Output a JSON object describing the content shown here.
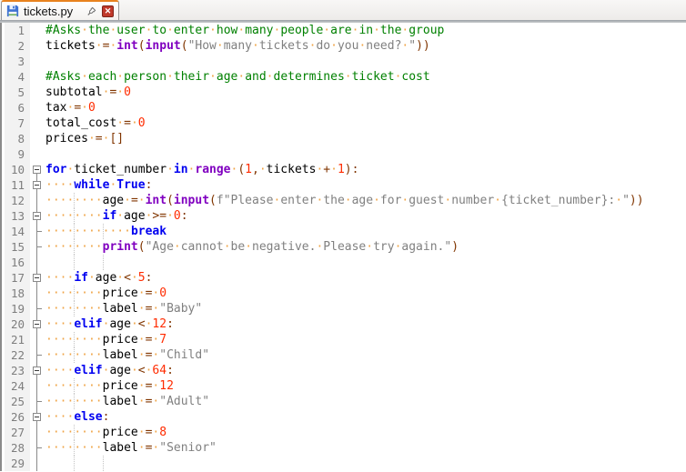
{
  "tab": {
    "title": "tickets.py",
    "close_glyph": "✕",
    "icons": {
      "save": "floppy-disk",
      "pin": "pushpin",
      "close": "close-x"
    }
  },
  "colors": {
    "taborange": "#e8821e",
    "linenum": "#7e7e7e",
    "foldgray": "#8a8a8a",
    "default_text": "#000000",
    "keyword": "#0000f0",
    "builtin": "#8000c0",
    "number": "#ff2b00",
    "operator": "#803500",
    "string": "#808080",
    "comment": "#008000",
    "whitespace_dot": "#efa344"
  },
  "editor": {
    "lines": [
      {
        "n": 1,
        "fold": "",
        "guides": [],
        "segs": [
          [
            "c",
            "#Asks the user to enter how many people are in the group"
          ]
        ]
      },
      {
        "n": 2,
        "fold": "",
        "guides": [],
        "segs": [
          [
            "d",
            "tickets "
          ],
          [
            "o",
            "="
          ],
          [
            "d",
            " "
          ],
          [
            "b",
            "int"
          ],
          [
            "o",
            "("
          ],
          [
            "b",
            "input"
          ],
          [
            "o",
            "("
          ],
          [
            "s",
            "\"How many tickets do you need? \""
          ],
          [
            "o",
            "))"
          ]
        ]
      },
      {
        "n": 3,
        "fold": "",
        "guides": [],
        "segs": []
      },
      {
        "n": 4,
        "fold": "",
        "guides": [],
        "segs": [
          [
            "c",
            "#Asks each person their age and determines ticket cost"
          ]
        ]
      },
      {
        "n": 5,
        "fold": "",
        "guides": [],
        "segs": [
          [
            "d",
            "subtotal "
          ],
          [
            "o",
            "="
          ],
          [
            "d",
            " "
          ],
          [
            "n",
            "0"
          ]
        ]
      },
      {
        "n": 6,
        "fold": "",
        "guides": [],
        "segs": [
          [
            "d",
            "tax "
          ],
          [
            "o",
            "="
          ],
          [
            "d",
            " "
          ],
          [
            "n",
            "0"
          ]
        ]
      },
      {
        "n": 7,
        "fold": "",
        "guides": [],
        "segs": [
          [
            "d",
            "total_cost "
          ],
          [
            "o",
            "="
          ],
          [
            "d",
            " "
          ],
          [
            "n",
            "0"
          ]
        ]
      },
      {
        "n": 8,
        "fold": "",
        "guides": [],
        "segs": [
          [
            "d",
            "prices "
          ],
          [
            "o",
            "="
          ],
          [
            "d",
            " "
          ],
          [
            "o",
            "[]"
          ]
        ]
      },
      {
        "n": 9,
        "fold": "",
        "guides": [],
        "segs": []
      },
      {
        "n": 10,
        "fold": "boxstart",
        "guides": [],
        "segs": [
          [
            "k",
            "for"
          ],
          [
            "d",
            " ticket_number "
          ],
          [
            "k",
            "in"
          ],
          [
            "d",
            " "
          ],
          [
            "b",
            "range"
          ],
          [
            "d",
            " "
          ],
          [
            "o",
            "("
          ],
          [
            "n",
            "1"
          ],
          [
            "o",
            ","
          ],
          [
            "d",
            " tickets "
          ],
          [
            "o",
            "+"
          ],
          [
            "d",
            " "
          ],
          [
            "n",
            "1"
          ],
          [
            "o",
            "):"
          ]
        ]
      },
      {
        "n": 11,
        "fold": "box",
        "guides": [],
        "segs": [
          [
            "d",
            "    "
          ],
          [
            "k",
            "while"
          ],
          [
            "d",
            " "
          ],
          [
            "k",
            "True"
          ],
          [
            "o",
            ":"
          ]
        ]
      },
      {
        "n": 12,
        "fold": "line",
        "guides": [
          4
        ],
        "segs": [
          [
            "d",
            "        age "
          ],
          [
            "o",
            "="
          ],
          [
            "d",
            " "
          ],
          [
            "b",
            "int"
          ],
          [
            "o",
            "("
          ],
          [
            "b",
            "input"
          ],
          [
            "o",
            "("
          ],
          [
            "s",
            "f\"Please enter the age for guest number {ticket_number}: \""
          ],
          [
            "o",
            "))"
          ]
        ]
      },
      {
        "n": 13,
        "fold": "box",
        "guides": [
          4
        ],
        "segs": [
          [
            "d",
            "        "
          ],
          [
            "k",
            "if"
          ],
          [
            "d",
            " age "
          ],
          [
            "o",
            ">="
          ],
          [
            "d",
            " "
          ],
          [
            "n",
            "0"
          ],
          [
            "o",
            ":"
          ]
        ]
      },
      {
        "n": 14,
        "fold": "tick",
        "guides": [
          4,
          8
        ],
        "segs": [
          [
            "d",
            "            "
          ],
          [
            "k",
            "break"
          ]
        ]
      },
      {
        "n": 15,
        "fold": "tick",
        "guides": [
          4
        ],
        "segs": [
          [
            "d",
            "        "
          ],
          [
            "b",
            "print"
          ],
          [
            "o",
            "("
          ],
          [
            "s",
            "\"Age cannot be negative. Please try again.\""
          ],
          [
            "o",
            ")"
          ]
        ]
      },
      {
        "n": 16,
        "fold": "line",
        "guides": [
          4,
          8
        ],
        "segs": []
      },
      {
        "n": 17,
        "fold": "box",
        "guides": [],
        "segs": [
          [
            "d",
            "    "
          ],
          [
            "k",
            "if"
          ],
          [
            "d",
            " age "
          ],
          [
            "o",
            "<"
          ],
          [
            "d",
            " "
          ],
          [
            "n",
            "5"
          ],
          [
            "o",
            ":"
          ]
        ]
      },
      {
        "n": 18,
        "fold": "line",
        "guides": [
          4
        ],
        "segs": [
          [
            "d",
            "        price "
          ],
          [
            "o",
            "="
          ],
          [
            "d",
            " "
          ],
          [
            "n",
            "0"
          ]
        ]
      },
      {
        "n": 19,
        "fold": "tick",
        "guides": [
          4
        ],
        "segs": [
          [
            "d",
            "        label "
          ],
          [
            "o",
            "="
          ],
          [
            "d",
            " "
          ],
          [
            "s",
            "\"Baby\""
          ]
        ]
      },
      {
        "n": 20,
        "fold": "box",
        "guides": [],
        "segs": [
          [
            "d",
            "    "
          ],
          [
            "k",
            "elif"
          ],
          [
            "d",
            " age "
          ],
          [
            "o",
            "<"
          ],
          [
            "d",
            " "
          ],
          [
            "n",
            "12"
          ],
          [
            "o",
            ":"
          ]
        ]
      },
      {
        "n": 21,
        "fold": "line",
        "guides": [
          4
        ],
        "segs": [
          [
            "d",
            "        price "
          ],
          [
            "o",
            "="
          ],
          [
            "d",
            " "
          ],
          [
            "n",
            "7"
          ]
        ]
      },
      {
        "n": 22,
        "fold": "tick",
        "guides": [
          4
        ],
        "segs": [
          [
            "d",
            "        label "
          ],
          [
            "o",
            "="
          ],
          [
            "d",
            " "
          ],
          [
            "s",
            "\"Child\""
          ]
        ]
      },
      {
        "n": 23,
        "fold": "box",
        "guides": [],
        "segs": [
          [
            "d",
            "    "
          ],
          [
            "k",
            "elif"
          ],
          [
            "d",
            " age "
          ],
          [
            "o",
            "<"
          ],
          [
            "d",
            " "
          ],
          [
            "n",
            "64"
          ],
          [
            "o",
            ":"
          ]
        ]
      },
      {
        "n": 24,
        "fold": "line",
        "guides": [
          4
        ],
        "segs": [
          [
            "d",
            "        price "
          ],
          [
            "o",
            "="
          ],
          [
            "d",
            " "
          ],
          [
            "n",
            "12"
          ]
        ]
      },
      {
        "n": 25,
        "fold": "tick",
        "guides": [
          4
        ],
        "segs": [
          [
            "d",
            "        label "
          ],
          [
            "o",
            "="
          ],
          [
            "d",
            " "
          ],
          [
            "s",
            "\"Adult\""
          ]
        ]
      },
      {
        "n": 26,
        "fold": "box",
        "guides": [],
        "segs": [
          [
            "d",
            "    "
          ],
          [
            "k",
            "else"
          ],
          [
            "o",
            ":"
          ]
        ]
      },
      {
        "n": 27,
        "fold": "line",
        "guides": [
          4
        ],
        "segs": [
          [
            "d",
            "        price "
          ],
          [
            "o",
            "="
          ],
          [
            "d",
            " "
          ],
          [
            "n",
            "8"
          ]
        ]
      },
      {
        "n": 28,
        "fold": "tick",
        "guides": [
          4
        ],
        "segs": [
          [
            "d",
            "        label "
          ],
          [
            "o",
            "="
          ],
          [
            "d",
            " "
          ],
          [
            "s",
            "\"Senior\""
          ]
        ]
      },
      {
        "n": 29,
        "fold": "line",
        "guides": [
          4,
          8
        ],
        "segs": []
      }
    ]
  }
}
